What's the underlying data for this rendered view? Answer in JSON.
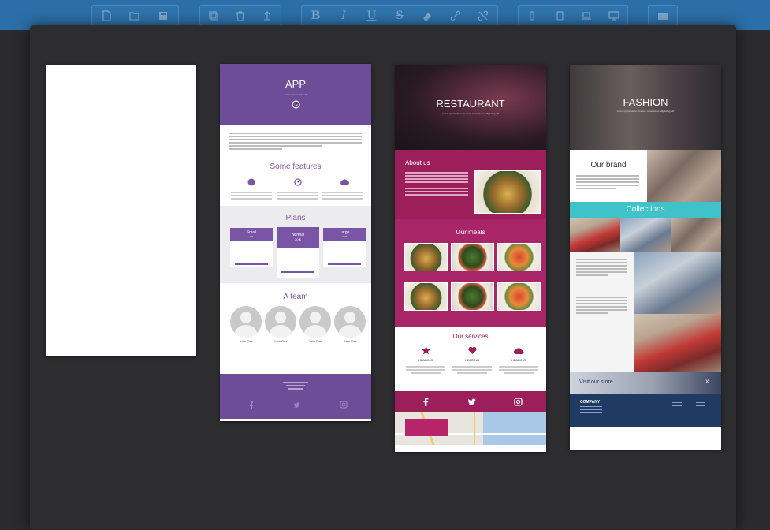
{
  "toolbar": {
    "groups": [
      [
        "new-file",
        "open-folder",
        "save"
      ],
      [
        "copy",
        "delete",
        "export"
      ],
      [
        "bold",
        "italic",
        "underline",
        "strikethrough",
        "eraser",
        "link",
        "unlink"
      ],
      [
        "mobile",
        "tablet",
        "laptop",
        "desktop"
      ],
      [
        "folder"
      ]
    ],
    "bold_glyph": "B",
    "italic_glyph": "I",
    "underline_glyph": "U",
    "strike_glyph": "S"
  },
  "colors": {
    "topbar": "#2c6fa8",
    "app_purple": "#6d4c98",
    "restaurant_magenta": "#9c1f5c",
    "fashion_teal": "#3fc3c9",
    "fashion_navy": "#1f3a63"
  },
  "templates": {
    "app": {
      "title": "APP",
      "features_title": "Some features",
      "plans_title": "Plans",
      "plans": [
        {
          "name": "Small",
          "price": "0 $"
        },
        {
          "name": "Normal",
          "price": "20 $"
        },
        {
          "name": "Large",
          "price": "40 $"
        }
      ],
      "team_title": "A team",
      "team": [
        "John Doe",
        "John Doe",
        "John Doe",
        "John Doe"
      ]
    },
    "restaurant": {
      "title": "RESTAURANT",
      "about_title": "About us",
      "meals_title": "Our meals",
      "services_title": "Our services",
      "service_headings": [
        "HEADING",
        "HEADING",
        "HEADING"
      ]
    },
    "fashion": {
      "title": "FASHION",
      "brand_title": "Our brand",
      "collections_title": "Collections",
      "store_link": "Visit our store",
      "store_arrow": "»",
      "company": "COMPANY"
    }
  }
}
